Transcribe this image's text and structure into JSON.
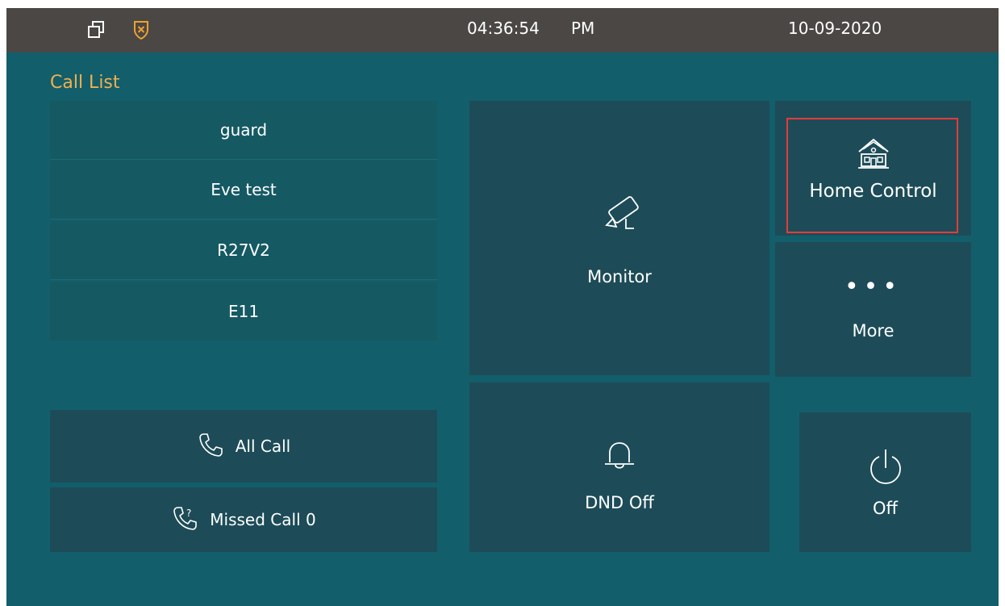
{
  "status_bar": {
    "time": "04:36:54",
    "ampm": "PM",
    "date": "10-09-2020",
    "icons": [
      "window-restore-icon",
      "shield-icon"
    ]
  },
  "call_list": {
    "title": "Call List",
    "contacts": [
      "guard",
      "Eve test",
      "R27V2",
      "E11"
    ]
  },
  "call_buttons": {
    "all_call": "All Call",
    "missed_call": "Missed Call 0"
  },
  "tiles": {
    "monitor": "Monitor",
    "home_control": "Home Control",
    "more": "More",
    "dnd": "DND Off",
    "power": "Off"
  },
  "colors": {
    "background": "#135e6b",
    "status_bar": "#4a4745",
    "title_accent": "#f0b04e",
    "highlight": "#e53b3b"
  }
}
